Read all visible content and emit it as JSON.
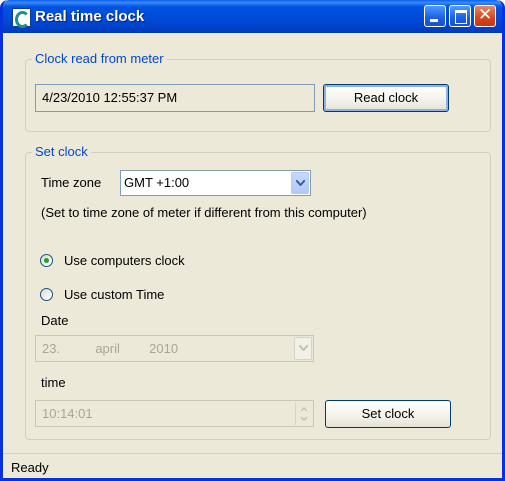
{
  "window": {
    "title": "Real time clock",
    "controls": {
      "minimize": "minimize-icon",
      "maximize": "maximize-icon",
      "close": "close-icon"
    }
  },
  "meter_group": {
    "legend": "Clock read from meter",
    "readout": "4/23/2010 12:55:37 PM",
    "read_button": "Read clock"
  },
  "set_group": {
    "legend": "Set clock",
    "timezone_label": "Time zone",
    "timezone_value": "GMT +1:00",
    "timezone_hint": "(Set to time zone of meter if different from this computer)",
    "radio_computer": "Use computers clock",
    "radio_computer_selected": true,
    "radio_custom": "Use custom Time",
    "date_label": "Date",
    "date_day": "23.",
    "date_month": "april",
    "date_year": "2010",
    "time_label": "time",
    "time_value": "10:14:01",
    "set_button": "Set clock"
  },
  "status": {
    "text": "Ready"
  },
  "colors": {
    "title_blue": "#0054e3",
    "legend_blue": "#0046d5",
    "radio_green": "#21a121",
    "close_red": "#d5441f"
  }
}
